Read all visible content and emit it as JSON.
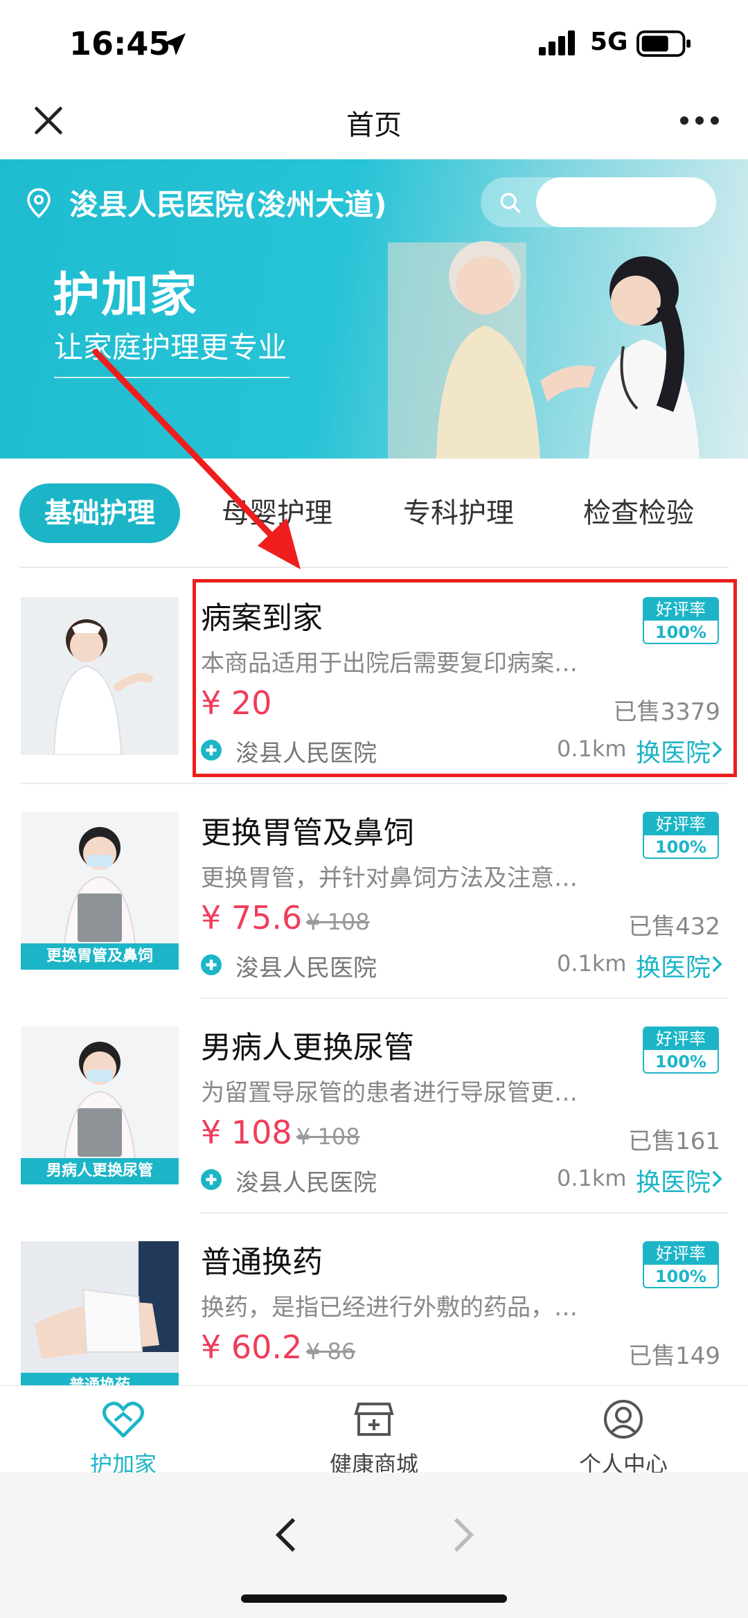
{
  "status_bar": {
    "time": "16:45",
    "network": "5G"
  },
  "nav": {
    "title": "首页"
  },
  "banner": {
    "hospital": "浚县人民医院(浚州大道)",
    "search_placeholder": "",
    "brand": "护加家",
    "slogan": "让家庭护理更专业"
  },
  "tabs": [
    "基础护理",
    "母婴护理",
    "专科护理",
    "检查检验"
  ],
  "products": [
    {
      "title": "病案到家",
      "desc": "本商品适用于出院后需要复印病案…",
      "price": "¥ 20",
      "original": "",
      "sold": "已售3379",
      "hospital": "浚县人民医院",
      "distance": "0.1km",
      "switch": "换医院",
      "rate_label": "好评率",
      "rate_value": "100%",
      "caption": ""
    },
    {
      "title": "更换胃管及鼻饲",
      "desc": "更换胃管，并针对鼻饲方法及注意…",
      "price": "¥ 75.6",
      "original": "¥ 108",
      "sold": "已售432",
      "hospital": "浚县人民医院",
      "distance": "0.1km",
      "switch": "换医院",
      "rate_label": "好评率",
      "rate_value": "100%",
      "caption": "更换胃管及鼻饲"
    },
    {
      "title": "男病人更换尿管",
      "desc": "为留置导尿管的患者进行导尿管更…",
      "price": "¥ 108",
      "original": "¥ 108",
      "sold": "已售161",
      "hospital": "浚县人民医院",
      "distance": "0.1km",
      "switch": "换医院",
      "rate_label": "好评率",
      "rate_value": "100%",
      "caption": "男病人更换尿管"
    },
    {
      "title": "普通换药",
      "desc": "换药，是指已经进行外敷的药品，…",
      "price": "¥ 60.2",
      "original": "¥ 86",
      "sold": "已售149",
      "hospital": "",
      "distance": "",
      "switch": "",
      "rate_label": "好评率",
      "rate_value": "100%",
      "caption": "普通换药"
    }
  ],
  "tab_bar": [
    "护加家",
    "健康商城",
    "个人中心"
  ],
  "colors": {
    "accent": "#1cb5c7",
    "price": "#f03c5a",
    "highlight": "#ee1e1e"
  }
}
